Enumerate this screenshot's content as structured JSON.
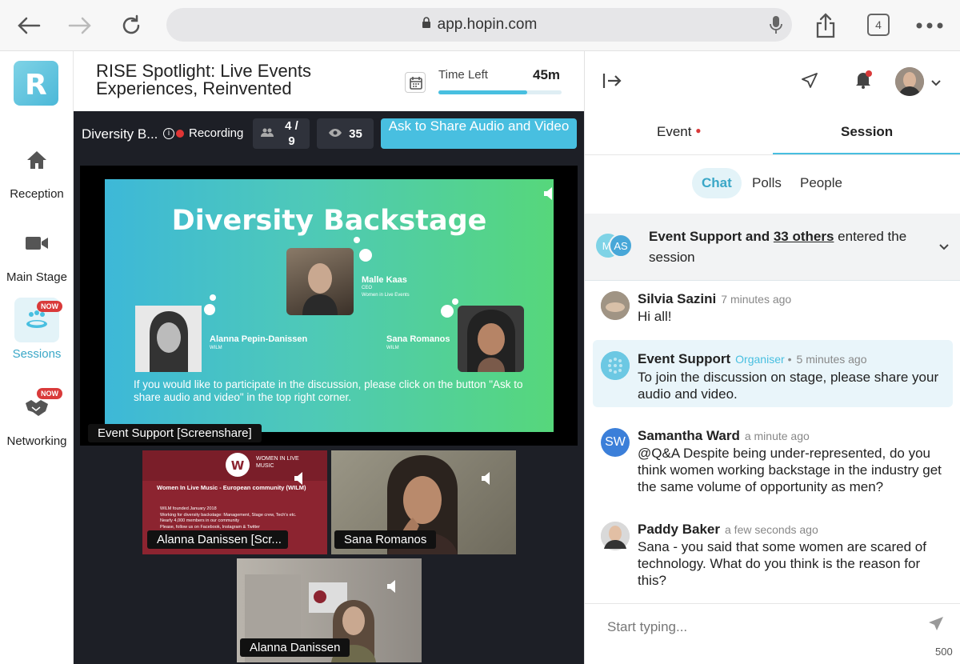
{
  "browser": {
    "url": "app.hopin.com",
    "tab_count": "4"
  },
  "sidebar": {
    "items": [
      {
        "label": "Reception",
        "badge": ""
      },
      {
        "label": "Main Stage",
        "badge": ""
      },
      {
        "label": "Sessions",
        "badge": "NOW"
      },
      {
        "label": "Networking",
        "badge": "NOW"
      }
    ]
  },
  "header": {
    "session_title": "RISE Spotlight: Live Events Experiences, Reinvented",
    "time_left_label": "Time Left",
    "time_left_value": "45m",
    "time_progress": 0.72
  },
  "stage": {
    "name": "Diversity B...",
    "recording_label": "Recording",
    "participants": "4 / 9",
    "viewers": "35",
    "ask_button": "Ask to Share Audio and Video",
    "screenshare_label": "Event Support [Screenshare]",
    "slide": {
      "title": "Diversity Backstage",
      "speakers": [
        {
          "name": "Malle Kaas",
          "title": "CEO",
          "org": "Women in Live Events"
        },
        {
          "name": "Alanna Pepin-Danissen",
          "org": "WILM"
        },
        {
          "name": "Sana Romanos",
          "org": "WILM"
        }
      ],
      "body": "If you would like to participate in the discussion, please click on the button \"Ask to share audio and video\" in the top right corner."
    },
    "tiles": [
      {
        "label": "Alanna Danissen [Scr...",
        "slide_title": "Women In Live Music - European community (WILM)",
        "logo_text": "WOMEN IN LIVE MUSIC",
        "bullets": [
          "WILM founded January 2018",
          "Working for diversity backstage: Management, Stage crew, Tech's etc.",
          "Nearly 4,000 members in our community",
          "Please, follow us on Facebook, Instagram & Twitter"
        ]
      },
      {
        "label": "Sana Romanos"
      },
      {
        "label": "Alanna Danissen"
      }
    ]
  },
  "panel": {
    "tabs": [
      "Event",
      "Session"
    ],
    "sub_tabs": [
      "Chat",
      "Polls",
      "People"
    ],
    "entered": {
      "avatars": [
        "MI",
        "AS"
      ],
      "prefix": "Event Support and ",
      "others": "33 others",
      "suffix": " entered the session"
    },
    "messages": [
      {
        "name": "Silvia Sazini",
        "role": "",
        "time": "7 minutes ago",
        "text": "Hi all!"
      },
      {
        "name": "Event Support",
        "role": "Organiser",
        "time": "5 minutes ago",
        "text": "To join the discussion on stage, please share your audio and video."
      },
      {
        "name": "Samantha Ward",
        "role": "",
        "initials": "SW",
        "time": "a minute ago",
        "text": "@Q&A Despite being under-represented, do you think women working backstage in the industry get the same volume of opportunity as men?"
      },
      {
        "name": "Paddy Baker",
        "role": "",
        "time": "a few seconds ago",
        "text": "Sana - you said that some women are scared of technology. What do you think is the reason for this?"
      }
    ],
    "composer": {
      "placeholder": "Start typing...",
      "char_count": "500"
    }
  },
  "colors": {
    "accent": "#48bfe0",
    "stage_bg": "#1d1f26",
    "badge": "#d93a3a"
  }
}
